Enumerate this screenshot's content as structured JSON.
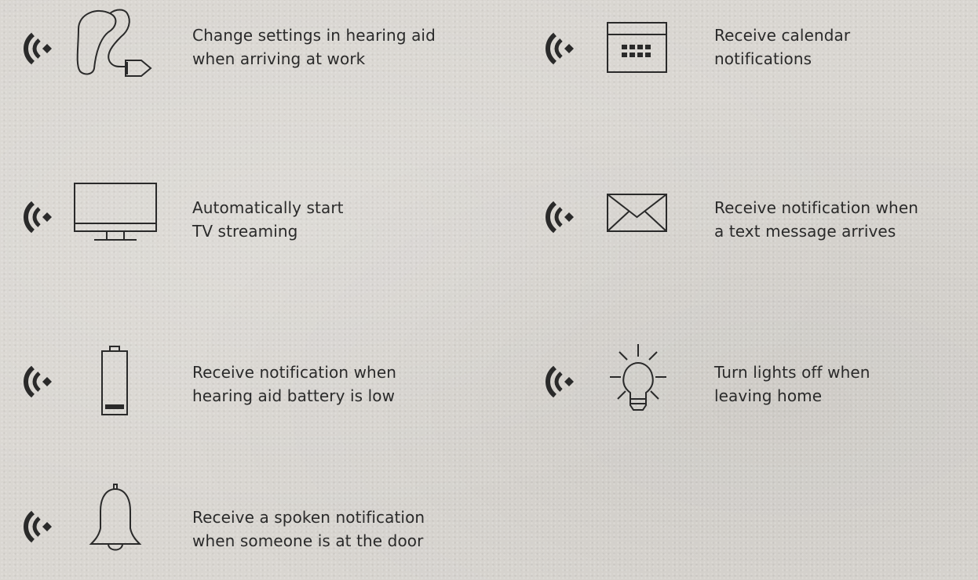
{
  "features": [
    {
      "icon": "hearing-aid-icon",
      "line1": "Change settings in hearing aid",
      "line2": "when arriving at work"
    },
    {
      "icon": "calendar-icon",
      "line1": "Receive calendar",
      "line2": "notifications"
    },
    {
      "icon": "tv-icon",
      "line1": "Automatically start",
      "line2": "TV streaming"
    },
    {
      "icon": "envelope-icon",
      "line1": "Receive notification when",
      "line2": "a text message arrives"
    },
    {
      "icon": "battery-low-icon",
      "line1": "Receive notification when",
      "line2": "hearing aid battery is low"
    },
    {
      "icon": "light-bulb-icon",
      "line1": "Turn lights off when",
      "line2": "leaving home"
    },
    {
      "icon": "doorbell-icon",
      "line1": "Receive a spoken notification",
      "line2": "when someone is at the door"
    }
  ],
  "colors": {
    "background": "#d9d6d1",
    "icon": "#2a2a2a",
    "text": "#2a2a2a"
  }
}
